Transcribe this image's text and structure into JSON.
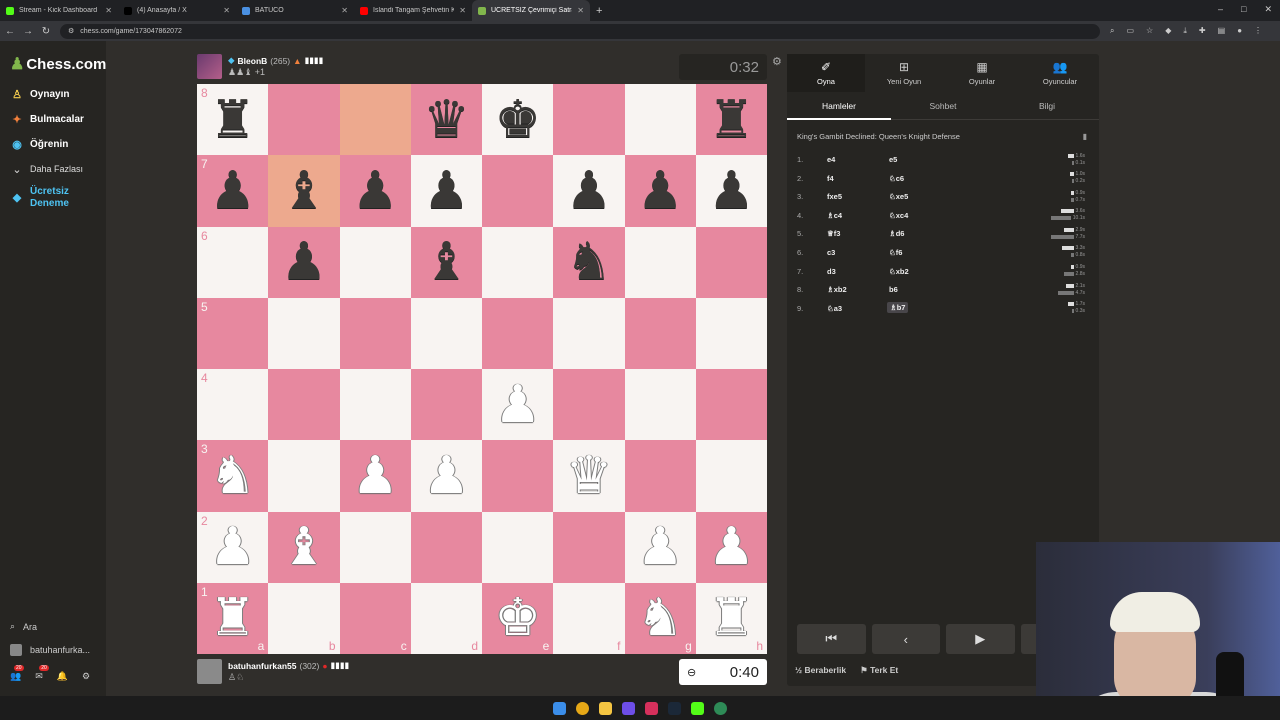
{
  "browser": {
    "tabs": [
      {
        "title": "Stream - Kick Dashboard",
        "color": "#53fc18",
        "active": false
      },
      {
        "title": "(4) Anasayfa / X",
        "color": "#000000",
        "active": false
      },
      {
        "title": "BATUCO",
        "color": "#4a90e2",
        "active": false
      },
      {
        "title": "İslandi Tangam Şehvetin K...",
        "color": "#ff0000",
        "active": false
      },
      {
        "title": "ÜCRETSİZ Çevrimiçi Satranç",
        "color": "#81b64c",
        "active": true
      }
    ],
    "new_tab": "+",
    "url": "chess.com/game/173047862072"
  },
  "sidebar": {
    "logo": "Chess.com",
    "items": [
      {
        "label": "Oynayın",
        "icon": "play-icon"
      },
      {
        "label": "Bulmacalar",
        "icon": "puzzle-icon"
      },
      {
        "label": "Öğrenin",
        "icon": "learn-icon"
      },
      {
        "label": "Daha Fazlası",
        "icon": "chevron-down-icon"
      },
      {
        "label": "Ücretsiz Deneme",
        "icon": "diamond-icon"
      }
    ],
    "search_label": "Ara",
    "user": "batuhanfurka...",
    "badges": [
      "20",
      "20"
    ]
  },
  "opponent": {
    "name": "BleonB",
    "rating": "(265)",
    "captured": "♟♟♝ +1",
    "clock": "0:32"
  },
  "player": {
    "name": "batuhanfurkan55",
    "rating": "(302)",
    "captured": "♙♘",
    "clock": "0:40"
  },
  "board": {
    "ranks": [
      "8",
      "7",
      "6",
      "5",
      "4",
      "3",
      "2",
      "1"
    ],
    "files": [
      "a",
      "b",
      "c",
      "d",
      "e",
      "f",
      "g",
      "h"
    ],
    "highlight": [
      "c8",
      "b7"
    ],
    "position": [
      [
        "r",
        "",
        "",
        "q",
        "k",
        "",
        "",
        "r"
      ],
      [
        "p",
        "b",
        "p",
        "p",
        "",
        "p",
        "p",
        "p"
      ],
      [
        "",
        "p",
        "",
        "b",
        "",
        "n",
        "",
        ""
      ],
      [
        "",
        "",
        "",
        "",
        "",
        "",
        "",
        ""
      ],
      [
        "",
        "",
        "",
        "",
        "P",
        "",
        "",
        ""
      ],
      [
        "N",
        "",
        "P",
        "P",
        "",
        "Q",
        "",
        ""
      ],
      [
        "P",
        "B",
        "",
        "",
        "",
        "",
        "P",
        "P"
      ],
      [
        "R",
        "",
        "",
        "",
        "K",
        "",
        "N",
        "R"
      ]
    ]
  },
  "panel": {
    "tabs": [
      {
        "label": "Oyna",
        "icon": "pawn-icon"
      },
      {
        "label": "Yeni Oyun",
        "icon": "plus-icon"
      },
      {
        "label": "Oyunlar",
        "icon": "board-icon"
      },
      {
        "label": "Oyuncular",
        "icon": "players-icon"
      }
    ],
    "subtabs": [
      "Hamleler",
      "Sohbet",
      "Bilgi"
    ],
    "opening": "King's Gambit Declined: Queen's Knight Defense",
    "moves": [
      {
        "n": "1.",
        "w": "e4",
        "b": "e5",
        "wt": "1.6s",
        "bt": "0.1s",
        "wf": 0.15,
        "bf": 0.02
      },
      {
        "n": "2.",
        "w": "f4",
        "b": "♘c6",
        "wt": "1.0s",
        "bt": "0.2s",
        "wf": 0.1,
        "bf": 0.03
      },
      {
        "n": "3.",
        "w": "fxe5",
        "b": "♘xe5",
        "wt": "0.9s",
        "bt": "0.7s",
        "wf": 0.08,
        "bf": 0.07
      },
      {
        "n": "4.",
        "w": "♗c4",
        "b": "♘xc4",
        "wt": "3.6s",
        "bt": "10.1s",
        "wf": 0.36,
        "bf": 1.0
      },
      {
        "n": "5.",
        "w": "♕f3",
        "b": "♗d6",
        "wt": "2.9s",
        "bt": "7.7s",
        "wf": 0.29,
        "bf": 0.76
      },
      {
        "n": "6.",
        "w": "c3",
        "b": "♘f6",
        "wt": "3.3s",
        "bt": "0.8s",
        "wf": 0.33,
        "bf": 0.08
      },
      {
        "n": "7.",
        "w": "d3",
        "b": "♘xb2",
        "wt": "0.9s",
        "bt": "2.8s",
        "wf": 0.09,
        "bf": 0.28
      },
      {
        "n": "8.",
        "w": "♗xb2",
        "b": "b6",
        "wt": "2.1s",
        "bt": "4.7s",
        "wf": 0.21,
        "bf": 0.47
      },
      {
        "n": "9.",
        "w": "♘a3",
        "b": "♗b7",
        "wt": "1.7s",
        "bt": "0.3s",
        "wf": 0.17,
        "bf": 0.03
      }
    ],
    "draw_label": "Beraberlik",
    "draw_icon": "½",
    "resign_label": "Terk Et"
  }
}
